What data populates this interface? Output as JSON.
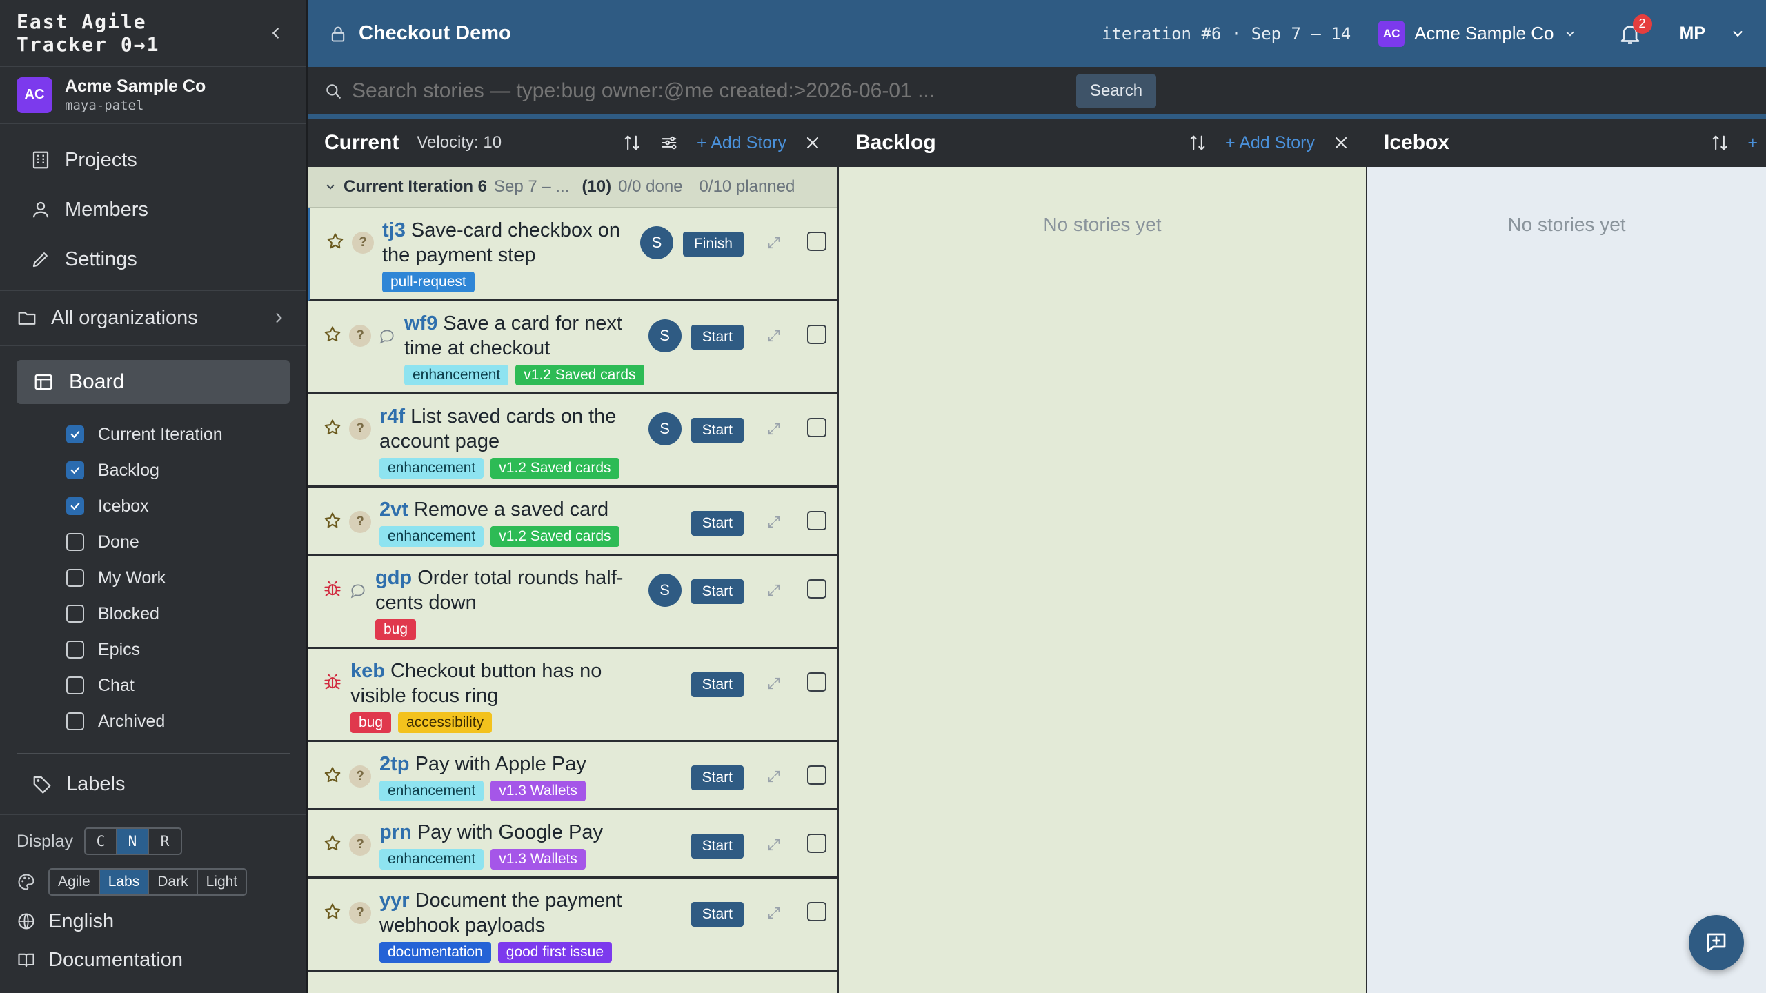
{
  "brand": {
    "line1": "East Agile",
    "line2": "Tracker 0→1"
  },
  "org": {
    "badge": "AC",
    "name": "Acme Sample Co",
    "user": "maya-patel"
  },
  "nav": {
    "projects": "Projects",
    "members": "Members",
    "settings": "Settings",
    "all_orgs": "All organizations",
    "board": "Board",
    "labels": "Labels"
  },
  "board_panels": [
    {
      "label": "Current Iteration",
      "checked": true
    },
    {
      "label": "Backlog",
      "checked": true
    },
    {
      "label": "Icebox",
      "checked": true
    },
    {
      "label": "Done",
      "checked": false
    },
    {
      "label": "My Work",
      "checked": false
    },
    {
      "label": "Blocked",
      "checked": false
    },
    {
      "label": "Epics",
      "checked": false
    },
    {
      "label": "Chat",
      "checked": false
    },
    {
      "label": "Archived",
      "checked": false
    }
  ],
  "display": {
    "label": "Display",
    "options": [
      "C",
      "N",
      "R"
    ],
    "selected": "N"
  },
  "theme": {
    "options": [
      "Agile",
      "Labs",
      "Dark",
      "Light"
    ],
    "selected": "Labs"
  },
  "language": "English",
  "documentation": "Documentation",
  "topbar": {
    "project": "Checkout Demo",
    "iteration": "iteration #6 · Sep 7 – 14",
    "account_badge": "AC",
    "account_name": "Acme Sample Co",
    "notifications": "2",
    "user_initials": "MP"
  },
  "search": {
    "placeholder": "Search stories — type:bug owner:@me created:>2026-06-01 ...",
    "button": "Search"
  },
  "current": {
    "title": "Current",
    "velocity": "Velocity: 10",
    "add_story": "+ Add Story",
    "iteration_label": "Current Iteration 6",
    "iteration_dates": "Sep 7 – ...",
    "iteration_points": "(10)",
    "iteration_done": "0/0 done",
    "iteration_planned": "0/10 planned",
    "stories": [
      {
        "id": "tj3",
        "title": "Save-card checkbox on the payment step",
        "type": "feature",
        "owner": "S",
        "action": "Finish",
        "comment": false,
        "tags": [
          {
            "text": "pull-request",
            "kind": "pr"
          }
        ]
      },
      {
        "id": "wf9",
        "title": "Save a card for next time at checkout",
        "type": "feature",
        "owner": "S",
        "action": "Start",
        "comment": true,
        "tags": [
          {
            "text": "enhancement",
            "kind": "enhancement"
          },
          {
            "text": "v1.2 Saved cards",
            "kind": "saved"
          }
        ]
      },
      {
        "id": "r4f",
        "title": "List saved cards on the account page",
        "type": "feature",
        "owner": "S",
        "action": "Start",
        "comment": false,
        "tags": [
          {
            "text": "enhancement",
            "kind": "enhancement"
          },
          {
            "text": "v1.2 Saved cards",
            "kind": "saved"
          }
        ]
      },
      {
        "id": "2vt",
        "title": "Remove a saved card",
        "type": "feature",
        "owner": "",
        "action": "Start",
        "comment": false,
        "tags": [
          {
            "text": "enhancement",
            "kind": "enhancement"
          },
          {
            "text": "v1.2 Saved cards",
            "kind": "saved"
          }
        ]
      },
      {
        "id": "gdp",
        "title": "Order total rounds half-cents down",
        "type": "bug",
        "owner": "S",
        "action": "Start",
        "comment": true,
        "tags": [
          {
            "text": "bug",
            "kind": "bug"
          }
        ]
      },
      {
        "id": "keb",
        "title": "Checkout button has no visible focus ring",
        "type": "bug",
        "owner": "",
        "action": "Start",
        "comment": false,
        "tags": [
          {
            "text": "bug",
            "kind": "bug"
          },
          {
            "text": "accessibility",
            "kind": "a11y"
          }
        ]
      },
      {
        "id": "2tp",
        "title": "Pay with Apple Pay",
        "type": "feature",
        "owner": "",
        "action": "Start",
        "comment": false,
        "tags": [
          {
            "text": "enhancement",
            "kind": "enhancement"
          },
          {
            "text": "v1.3 Wallets",
            "kind": "wallets"
          }
        ]
      },
      {
        "id": "prn",
        "title": "Pay with Google Pay",
        "type": "feature",
        "owner": "",
        "action": "Start",
        "comment": false,
        "tags": [
          {
            "text": "enhancement",
            "kind": "enhancement"
          },
          {
            "text": "v1.3 Wallets",
            "kind": "wallets"
          }
        ]
      },
      {
        "id": "yyr",
        "title": "Document the payment webhook payloads",
        "type": "feature",
        "owner": "",
        "action": "Start",
        "comment": false,
        "tags": [
          {
            "text": "documentation",
            "kind": "docs"
          },
          {
            "text": "good first issue",
            "kind": "gfi"
          }
        ]
      }
    ]
  },
  "backlog": {
    "title": "Backlog",
    "add_story": "+ Add Story",
    "empty": "No stories yet"
  },
  "icebox": {
    "title": "Icebox",
    "empty": "No stories yet"
  }
}
